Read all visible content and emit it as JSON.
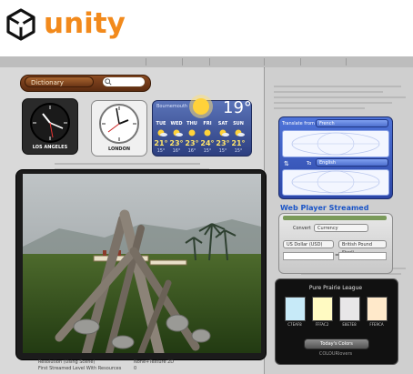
{
  "brand": {
    "name": "unity",
    "color": "#f28a1c",
    "logo_icon": "unity-cube-icon"
  },
  "dictionary": {
    "selected": "Dictionary",
    "search_placeholder": ""
  },
  "clocks": [
    {
      "city": "LOS ANGELES",
      "theme": "dark"
    },
    {
      "city": "LONDON",
      "theme": "light"
    }
  ],
  "weather": {
    "city": "Bournemouth",
    "current_temp": "19°",
    "days": [
      {
        "day": "TUE",
        "high": "21°",
        "low": "15°"
      },
      {
        "day": "WED",
        "high": "23°",
        "low": "16°"
      },
      {
        "day": "THU",
        "high": "23°",
        "low": "16°"
      },
      {
        "day": "FRI",
        "high": "24°",
        "low": "15°"
      },
      {
        "day": "SAT",
        "high": "23°",
        "low": "15°"
      },
      {
        "day": "SUN",
        "high": "21°",
        "low": "15°"
      }
    ]
  },
  "translate": {
    "from_label": "Translate from",
    "from_value": "French",
    "to_label": "To",
    "to_value": "English",
    "swap_icon": "swap-arrows-icon"
  },
  "web_player_caption": "Web Player Streamed",
  "currency": {
    "convert_label": "Convert",
    "convert_value": "Currency",
    "from_value": "US Dollar (USD)",
    "to_value": "British Pound Sterli...",
    "equals": "="
  },
  "palette": {
    "title": "Pure Prairie League",
    "swatches": [
      {
        "hex": "#C7EAF8",
        "code": "C7EAF8"
      },
      {
        "hex": "#FFFAC2",
        "code": "FFFAC2"
      },
      {
        "hex": "#E8E7E8",
        "code": "E8E7E8"
      },
      {
        "hex": "#FFE9CA",
        "code": "FFE9CA"
      }
    ],
    "selector": "Today's Colors",
    "footer": "COLOURlovers"
  },
  "player_status": {
    "line1_label": "Resolution (Using Scene)",
    "line1_value": "None+Texture 2D",
    "line2_label": "First Streamed Level With Resources",
    "line2_value": "0"
  }
}
